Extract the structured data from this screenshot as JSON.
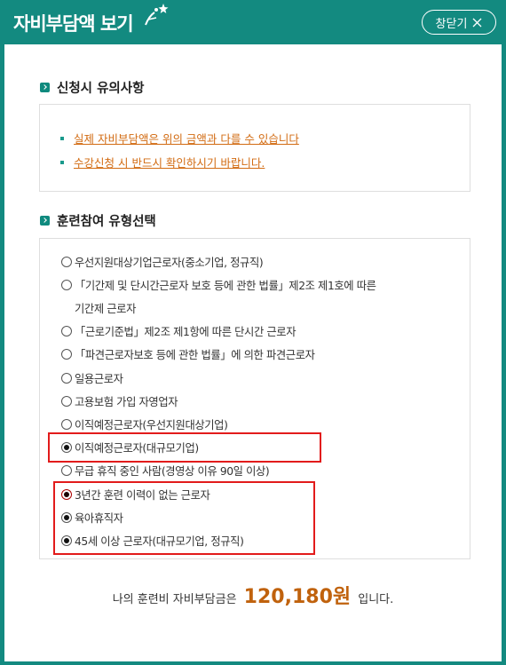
{
  "window": {
    "title": "자비부담액 보기",
    "close_label": "창닫기"
  },
  "notice": {
    "heading": "신청시 유의사항",
    "items": [
      "실제 자비부담액은 위의 금액과 다를 수 있습니다",
      "수강신청 시 반드시 확인하시기 바랍니다."
    ]
  },
  "types": {
    "heading": "훈련참여 유형선택",
    "options": [
      {
        "label": "우선지원대상기업근로자(중소기업, 정규직)",
        "checked": false
      },
      {
        "label": "「기간제 및 단시간근로자 보호 등에 관한 법률」제2조 제1호에 따른",
        "cont": "기간제 근로자",
        "checked": false
      },
      {
        "label": "「근로기준법」제2조 제1항에 따른 단시간 근로자",
        "checked": false
      },
      {
        "label": "「파견근로자보호 등에 관한 법률」에 의한 파견근로자",
        "checked": false
      },
      {
        "label": "일용근로자",
        "checked": false
      },
      {
        "label": "고용보험 가입 자영업자",
        "checked": false
      },
      {
        "label": "이직예정근로자(우선지원대상기업)",
        "checked": false
      },
      {
        "label": "이직예정근로자(대규모기업)",
        "checked": true
      },
      {
        "label": "무급 휴직 중인 사람(경영상 이유 90일 이상)",
        "checked": false
      },
      {
        "label": "3년간 훈련 이력이 없는 근로자",
        "checked": true
      },
      {
        "label": "육아휴직자",
        "checked": true
      },
      {
        "label": "45세 이상 근로자(대규모기업, 정규직)",
        "checked": true
      }
    ]
  },
  "summary": {
    "prefix": "나의 훈련비 자비부담금은",
    "amount": "120,180원",
    "suffix": "입니다."
  }
}
